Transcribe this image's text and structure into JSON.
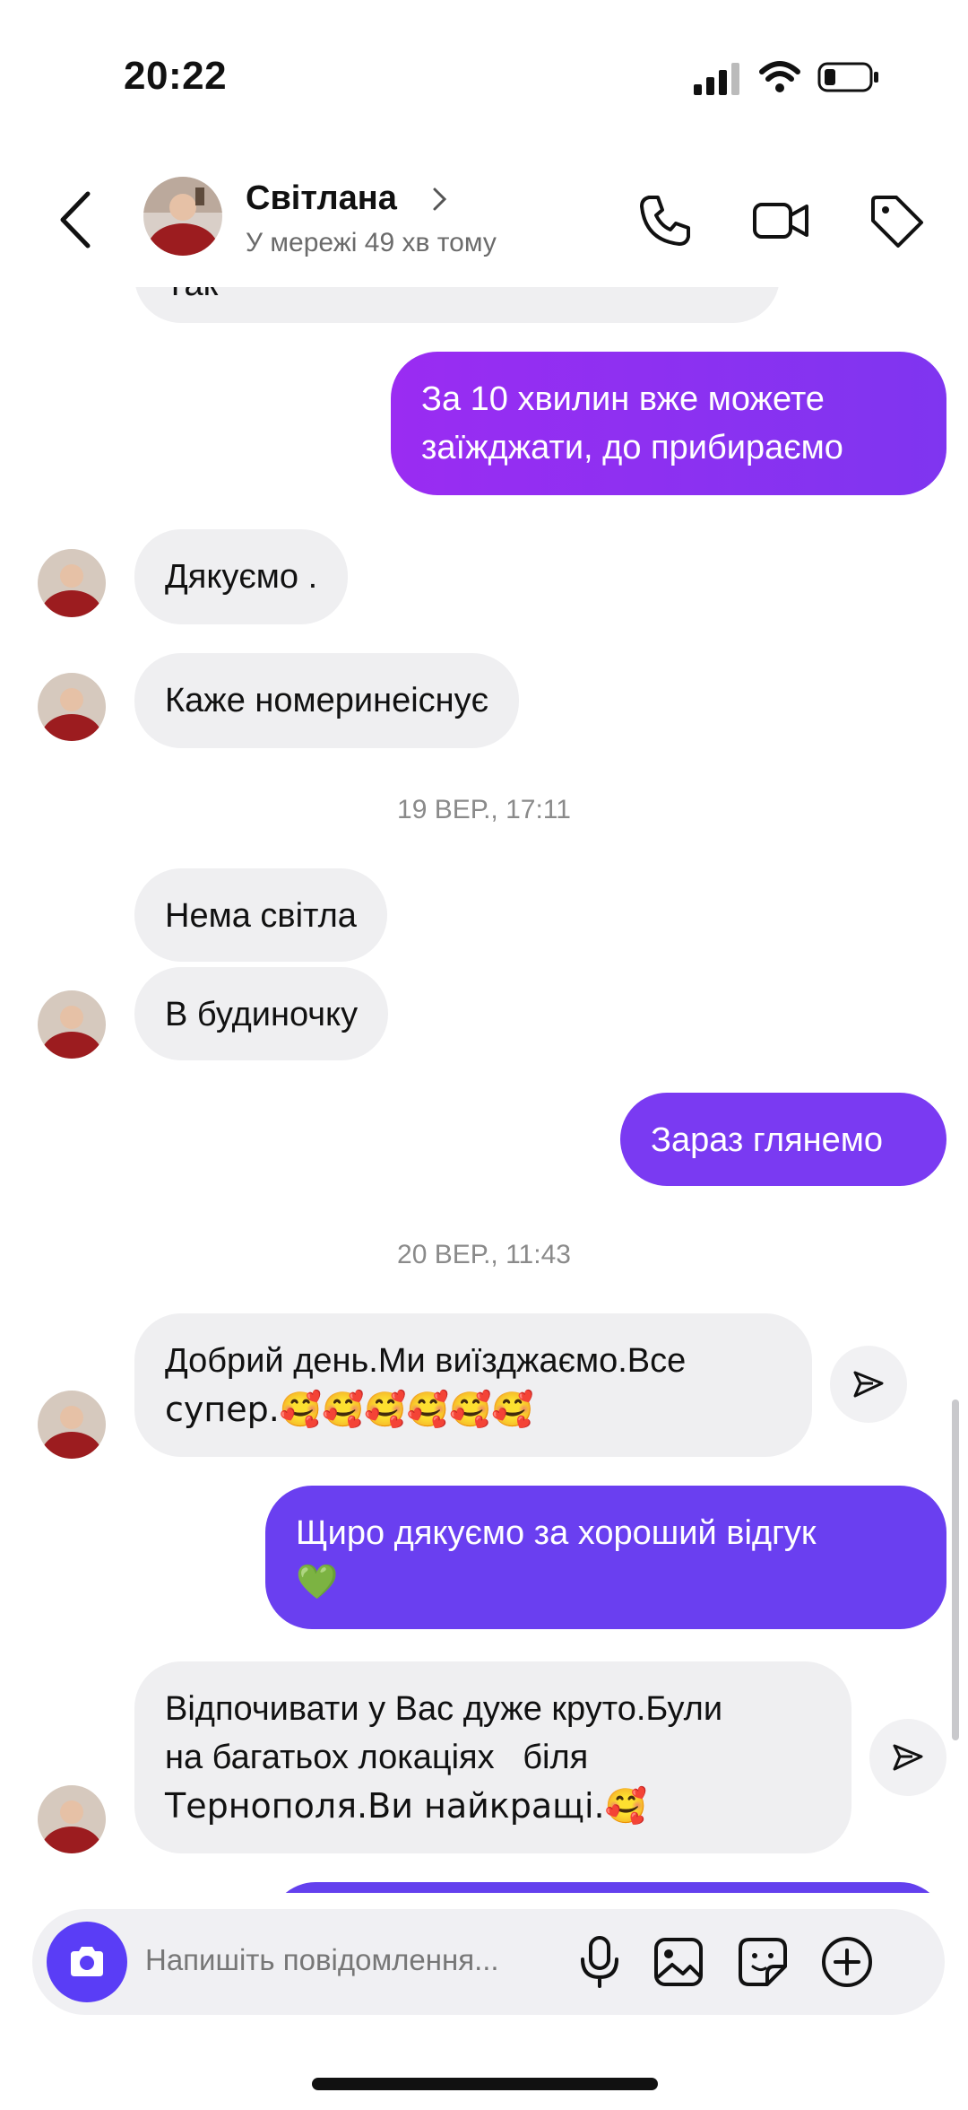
{
  "status_bar": {
    "time": "20:22"
  },
  "header": {
    "name": "Світлана",
    "status": "У мережі 49 хв тому"
  },
  "thread": {
    "partial_top": "Так",
    "messages": [
      {
        "dir": "out",
        "text": [
          "За 10 хвилин вже можете",
          "заїжджати, до прибираємо"
        ]
      },
      {
        "dir": "in",
        "text": [
          "Дякуємо ."
        ]
      },
      {
        "dir": "in",
        "text": [
          "Каже номеринеіснує"
        ]
      },
      {
        "dir": "ts",
        "text": "19 ВЕР., 17:11"
      },
      {
        "dir": "in",
        "text": [
          "Нема світла"
        ]
      },
      {
        "dir": "in",
        "text": [
          "В будиночку"
        ]
      },
      {
        "dir": "out",
        "text": [
          "Зараз глянемо"
        ]
      },
      {
        "dir": "ts",
        "text": "20 ВЕР., 11:43"
      },
      {
        "dir": "in",
        "text": [
          "Добрий день.Ми виїзджаємо.Все",
          "супер.🥰🥰🥰🥰🥰🥰"
        ]
      },
      {
        "dir": "out",
        "text": [
          "Щиро дякуємо за хороший відгук",
          "💚"
        ]
      },
      {
        "dir": "in",
        "text": [
          "Відпочивати у Вас дуже круто.Були",
          "на багатьох локаціях   біля",
          "Тернополя.Ви найкращі.🥰"
        ]
      }
    ]
  },
  "composer": {
    "placeholder": "Напишіть повідомлення..."
  },
  "colors": {
    "out_gradient_start": "#8b2cf5",
    "out_gradient_end": "#6a3df0",
    "in_bubble": "#efeff1",
    "accent": "#5a3df6"
  }
}
